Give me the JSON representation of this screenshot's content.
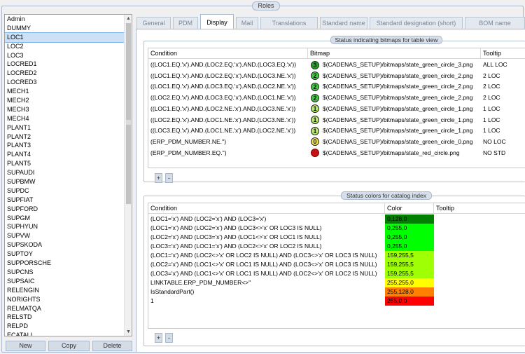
{
  "window": {
    "title": "Roles"
  },
  "roles": {
    "items": [
      "Admin",
      "DUMMY",
      "LOC1",
      "LOC2",
      "LOC3",
      "LOCRED1",
      "LOCRED2",
      "LOCRED3",
      "MECH1",
      "MECH2",
      "MECH3",
      "MECH4",
      "PLANT1",
      "PLANT2",
      "PLANT3",
      "PLANT4",
      "PLANT5",
      "SUPAUDI",
      "SUPBMW",
      "SUPDC",
      "SUPFIAT",
      "SUPFORD",
      "SUPGM",
      "SUPHYUN",
      "SUPVW",
      "SUPSKODA",
      "SUPTOY",
      "SUPPORSCHE",
      "SUPCNS",
      "SUPSAIC",
      "RELENGIN",
      "NORIGHTS",
      "RELMATQA",
      "RELSTD",
      "RELPD",
      "ECATALI"
    ],
    "selected": "LOC1"
  },
  "buttons": {
    "new": "New",
    "copy": "Copy",
    "delete": "Delete",
    "add": "+",
    "remove": "-"
  },
  "tabs": [
    "General",
    "PDM",
    "Display",
    "Mail",
    "Translations",
    "Standard name",
    "Standard designation (short)",
    "BOM name"
  ],
  "active_tab": "Display",
  "bitmap_section": {
    "title": "Status indicating bitmaps for table view",
    "columns": [
      "Condition",
      "Bitmap",
      "Tooltip"
    ],
    "rows": [
      {
        "condition": "((LOC1.EQ.'x').AND.(LOC2.EQ.'x').AND.(LOC3.EQ.'x'))",
        "icon_num": "3",
        "icon_color": "#1fae1f",
        "bitmap": "$(CADENAS_SETUP)/bitmaps/state_green_circle_3.png",
        "tooltip": "ALL LOC"
      },
      {
        "condition": "((LOC1.EQ.'x').AND.(LOC2.EQ.'x').AND.(LOC3.NE.'x'))",
        "icon_num": "2",
        "icon_color": "#3dcf3d",
        "bitmap": "$(CADENAS_SETUP)/bitmaps/state_green_circle_2.png",
        "tooltip": "2 LOC"
      },
      {
        "condition": "((LOC1.EQ.'x').AND.(LOC3.EQ.'x').AND.(LOC2.NE.'x'))",
        "icon_num": "2",
        "icon_color": "#3dcf3d",
        "bitmap": "$(CADENAS_SETUP)/bitmaps/state_green_circle_2.png",
        "tooltip": "2 LOC"
      },
      {
        "condition": "((LOC2.EQ.'x').AND.(LOC3.EQ.'x').AND.(LOC1.NE.'x'))",
        "icon_num": "2",
        "icon_color": "#3dcf3d",
        "bitmap": "$(CADENAS_SETUP)/bitmaps/state_green_circle_2.png",
        "tooltip": "2 LOC"
      },
      {
        "condition": "((LOC1.EQ.'x').AND.(LOC2.NE.'x').AND.(LOC3.NE.'x'))",
        "icon_num": "1",
        "icon_color": "#b6ea6c",
        "bitmap": "$(CADENAS_SETUP)/bitmaps/state_green_circle_1.png",
        "tooltip": "1 LOC"
      },
      {
        "condition": "((LOC2.EQ.'x').AND.(LOC1.NE.'x').AND.(LOC3.NE.'x'))",
        "icon_num": "1",
        "icon_color": "#b6ea6c",
        "bitmap": "$(CADENAS_SETUP)/bitmaps/state_green_circle_1.png",
        "tooltip": "1 LOC"
      },
      {
        "condition": "((LOC3.EQ.'x').AND.(LOC1.NE.'x').AND.(LOC2.NE.'x'))",
        "icon_num": "1",
        "icon_color": "#b6ea6c",
        "bitmap": "$(CADENAS_SETUP)/bitmaps/state_green_circle_1.png",
        "tooltip": "1 LOC"
      },
      {
        "condition": "(ERP_PDM_NUMBER.NE.'')",
        "icon_num": "0",
        "icon_color": "#f4e64a",
        "bitmap": "$(CADENAS_SETUP)/bitmaps/state_green_circle_0.png",
        "tooltip": "NO LOC"
      },
      {
        "condition": "(ERP_PDM_NUMBER.EQ.'')",
        "icon_num": "",
        "icon_color": "#c41212",
        "bitmap": "$(CADENAS_SETUP)/bitmaps/state_red_circle.png",
        "tooltip": "NO STD"
      }
    ]
  },
  "color_section": {
    "title": "Status colors for catalog index",
    "columns": [
      "Condition",
      "Color",
      "Tooltip"
    ],
    "rows": [
      {
        "condition": "(LOC1='x') AND (LOC2='x') AND (LOC3='x')",
        "color": "0,128,0",
        "hex": "#008000"
      },
      {
        "condition": "(LOC1='x') AND (LOC2='x') AND (LOC3<>'x' OR LOC3 IS NULL)",
        "color": "0,255,0",
        "hex": "#00ff00"
      },
      {
        "condition": "(LOC2='x') AND (LOC3='x') AND (LOC1<>'x' OR LOC1 IS NULL)",
        "color": "0,255,0",
        "hex": "#00ff00"
      },
      {
        "condition": "(LOC3='x') AND (LOC1='x') AND (LOC2<>'x' OR LOC2 IS NULL)",
        "color": "0,255,0",
        "hex": "#00ff00"
      },
      {
        "condition": "(LOC1='x') AND (LOC2<>'x' OR LOC2 IS NULL) AND (LOC3<>'x' OR LOC3 IS NULL)",
        "color": "159,255,5",
        "hex": "#9fff05"
      },
      {
        "condition": "(LOC2='x') AND (LOC1<>'x' OR LOC1 IS NULL) AND (LOC3<>'x' OR LOC3 IS NULL)",
        "color": "159,255,5",
        "hex": "#9fff05"
      },
      {
        "condition": "(LOC3='x') AND (LOC1<>'x' OR LOC1 IS NULL) AND (LOC2<>'x' OR LOC2 IS NULL)",
        "color": "159,255,5",
        "hex": "#9fff05"
      },
      {
        "condition": "LINKTABLE.ERP_PDM_NUMBER<>''",
        "color": "255,255,0",
        "hex": "#ffff00"
      },
      {
        "condition": "IsStandardPart()",
        "color": "255,128,0",
        "hex": "#ff8000"
      },
      {
        "condition": "1",
        "color": "255,0,0",
        "hex": "#ff0000"
      }
    ]
  }
}
